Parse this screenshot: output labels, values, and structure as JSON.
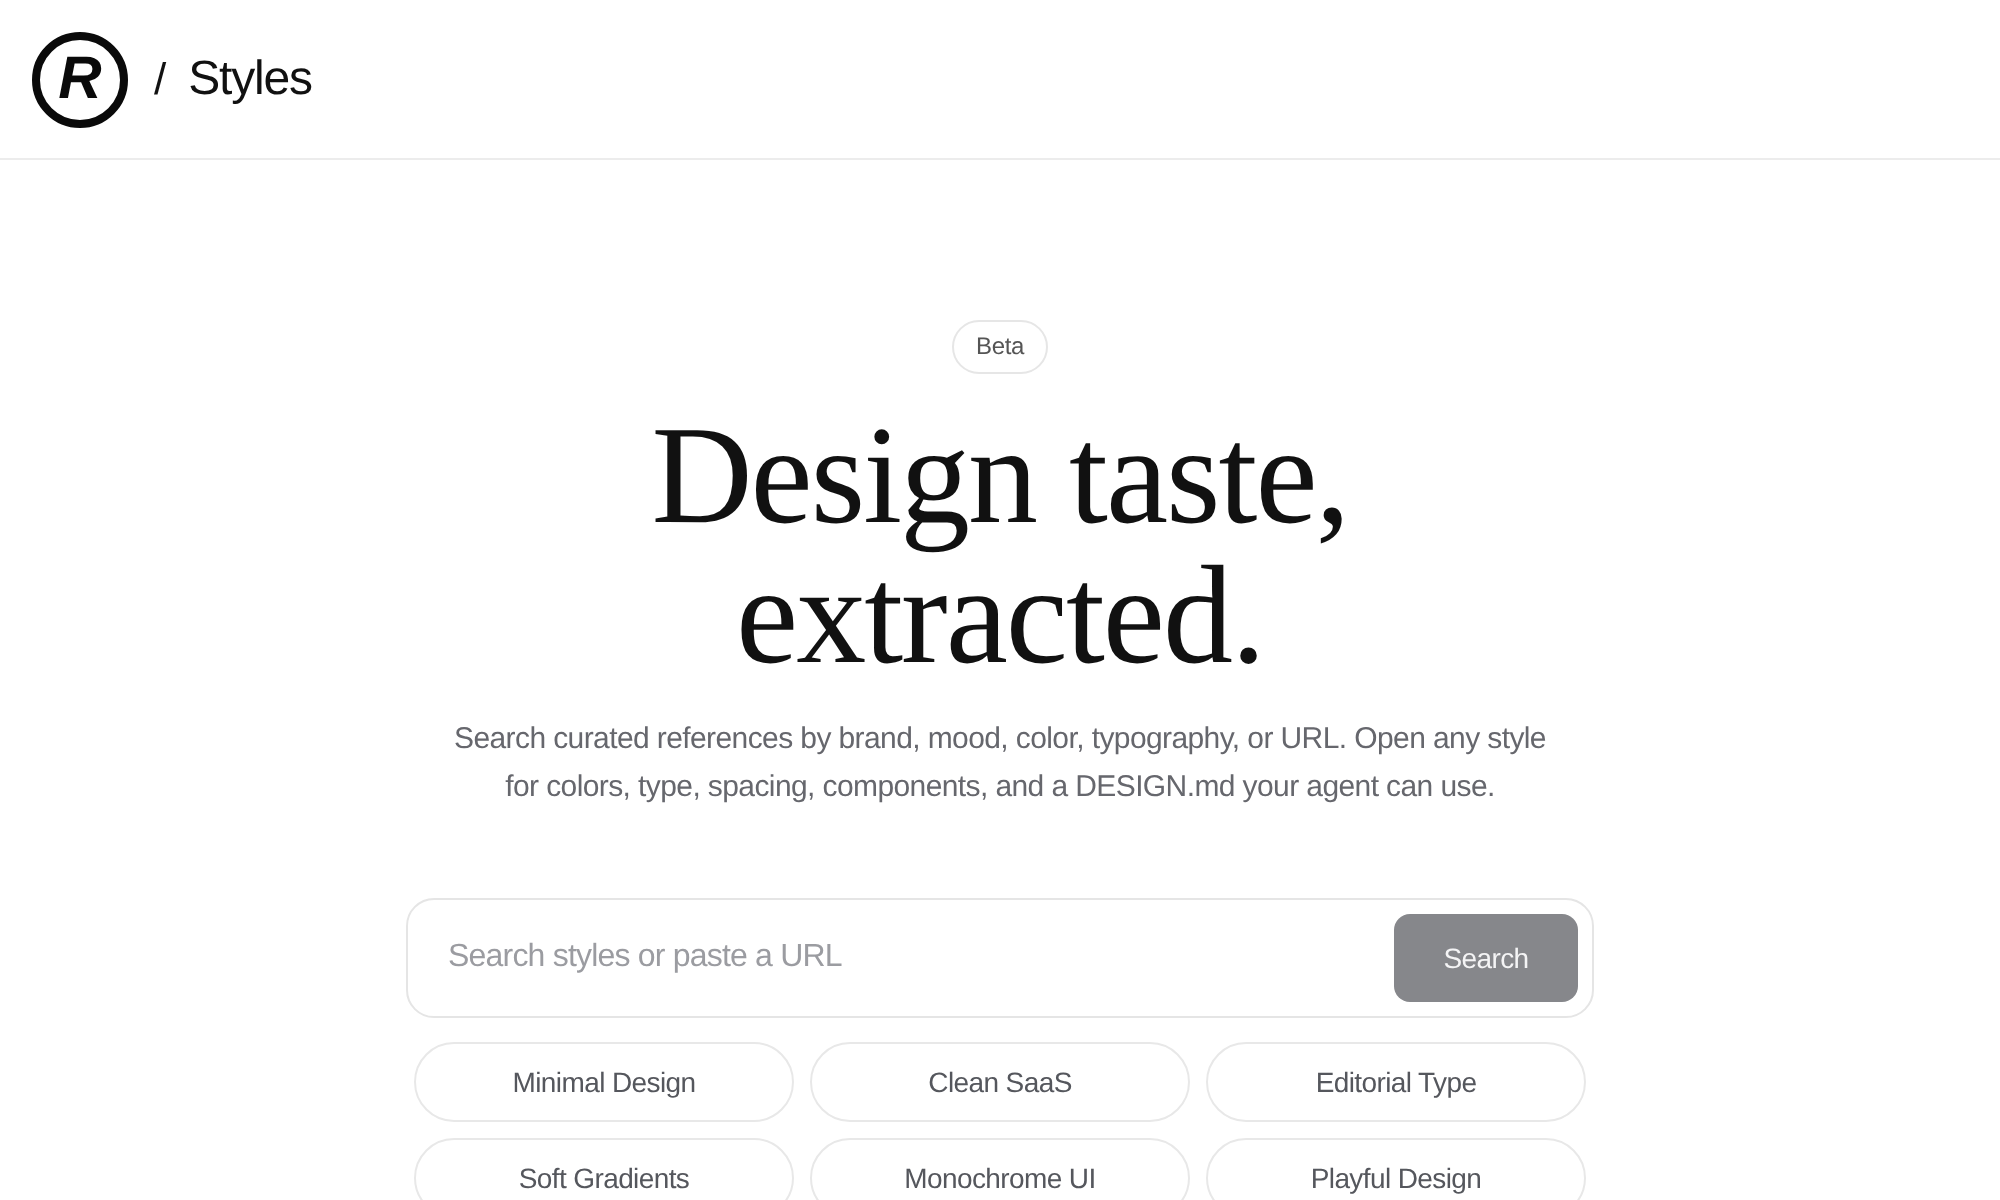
{
  "header": {
    "logo": "R",
    "separator": "/",
    "title": "Styles"
  },
  "hero": {
    "badge": "Beta",
    "heading": "Design taste, extracted.",
    "subtitle": "Search curated references by brand, mood, color, typography, or URL. Open any style for colors, type, spacing, components, and a DESIGN.md your agent can use."
  },
  "search": {
    "placeholder": "Search styles or paste a URL",
    "button": {
      "label": "Search",
      "disabled": true
    }
  },
  "suggestions": [
    {
      "label": "Minimal Design"
    },
    {
      "label": "Clean SaaS"
    },
    {
      "label": "Editorial Type"
    },
    {
      "label": "Soft Gradients"
    },
    {
      "label": "Monochrome UI"
    },
    {
      "label": "Playful Design"
    }
  ]
}
